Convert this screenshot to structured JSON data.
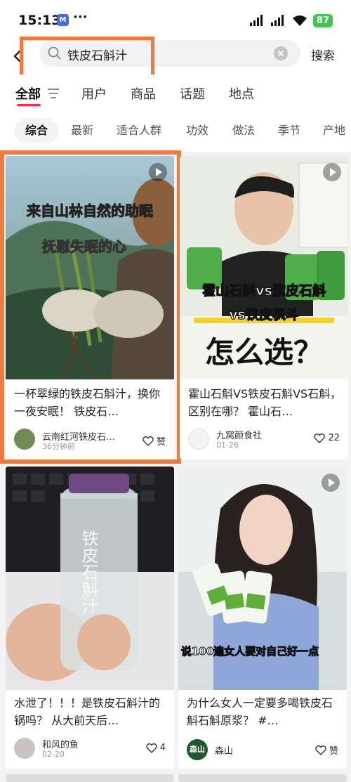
{
  "status": {
    "time": "15:13",
    "badge": "M",
    "dots": "···",
    "battery": "87"
  },
  "search": {
    "query": "铁皮石斛汁",
    "submit_label": "搜索"
  },
  "tabs": [
    {
      "label": "全部"
    },
    {
      "label": "用户"
    },
    {
      "label": "商品"
    },
    {
      "label": "话题"
    },
    {
      "label": "地点"
    }
  ],
  "chips": [
    {
      "label": "综合"
    },
    {
      "label": "最新"
    },
    {
      "label": "适合人群"
    },
    {
      "label": "功效"
    },
    {
      "label": "做法"
    },
    {
      "label": "季节"
    },
    {
      "label": "产地"
    }
  ],
  "cards": [
    {
      "image_text": [
        "来自山林自然的助眠",
        "抚慰失眠的心"
      ],
      "title": "一杯翠绿的铁皮石斛汁，换你一夜安眠！ 铁皮石…",
      "author": "云南红河铁皮石…",
      "time": "36分钟前",
      "likes": "赞",
      "has_video": true
    },
    {
      "image_text": [
        "霍山石斛vs紫皮石斛",
        "vs铁皮枫斗",
        "怎么选？"
      ],
      "title": "霍山石斛VS铁皮石斛VS石斛，区别在哪？ 霍山石…",
      "author": "九窝颜食社",
      "time": "01-26",
      "likes": "22",
      "has_video": true
    },
    {
      "image_text": [
        "铁皮石斛汁"
      ],
      "title": "水泄了！！！是铁皮石斛汁的锅吗？ 从大前天后…",
      "author": "和风的鱼",
      "time": "02-20",
      "likes": "4",
      "has_video": false
    },
    {
      "image_text": [
        "说100遍女人要对自己好一点"
      ],
      "title": "为什么女人一定要多喝铁皮石斛石斛原浆？ #…",
      "author": "森山",
      "author_avatar_text": "森山",
      "time": "",
      "likes": "赞",
      "has_video": true
    }
  ]
}
